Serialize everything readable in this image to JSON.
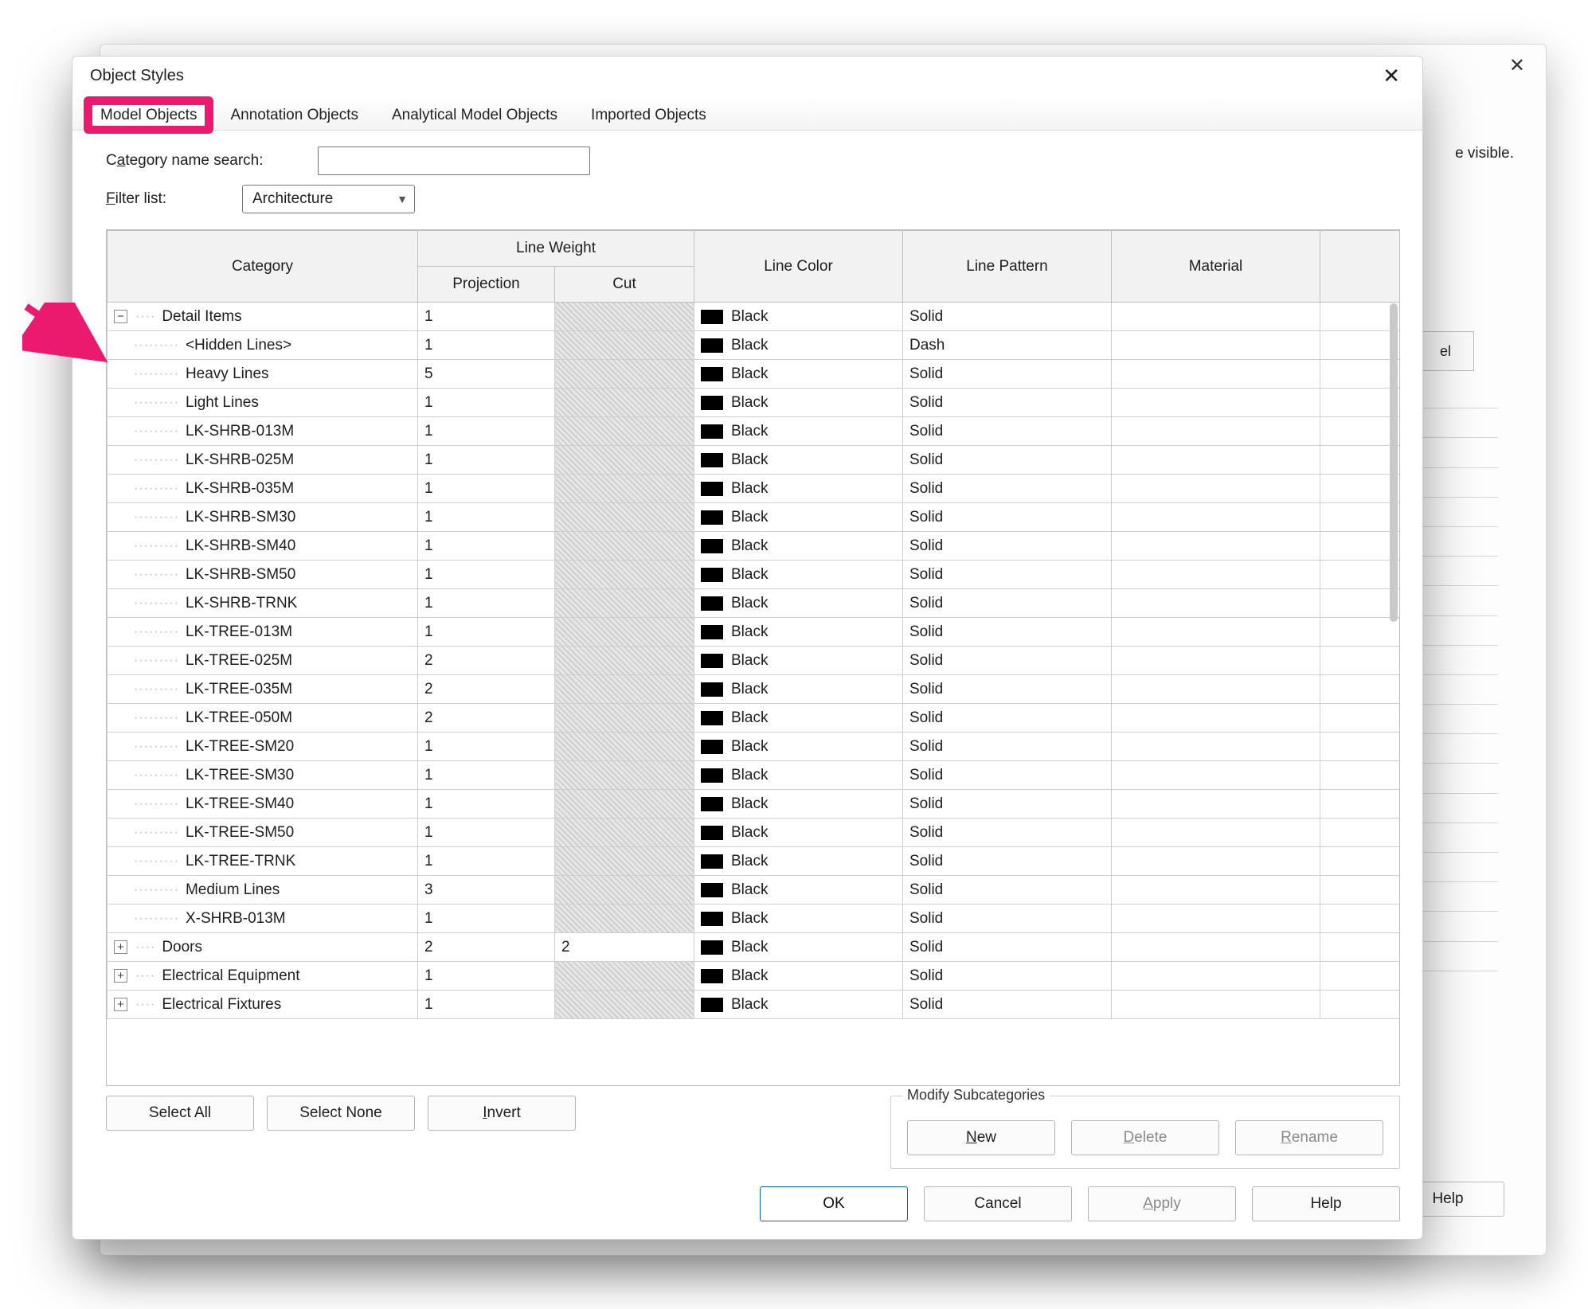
{
  "dialog": {
    "title": "Object Styles"
  },
  "tabs": {
    "model": "Model Objects",
    "annotation": "Annotation Objects",
    "analytical": "Analytical Model Objects",
    "imported": "Imported Objects"
  },
  "labels": {
    "category_search_pre": "C",
    "category_search_un": "a",
    "category_search_post": "tegory name search:",
    "filter_un": "F",
    "filter_post": "ilter list:",
    "filter_value": "Architecture"
  },
  "headers": {
    "category": "Category",
    "line_weight": "Line Weight",
    "projection": "Projection",
    "cut": "Cut",
    "line_color": "Line Color",
    "line_pattern": "Line Pattern",
    "material": "Material"
  },
  "color_black": "Black",
  "rows": [
    {
      "toggle": "minus",
      "indent": 0,
      "name": "Detail Items",
      "proj": "1",
      "cut": "disabled",
      "pattern": "Solid"
    },
    {
      "toggle": "",
      "indent": 1,
      "name": "<Hidden Lines>",
      "proj": "1",
      "cut": "disabled",
      "pattern": "Dash"
    },
    {
      "toggle": "",
      "indent": 1,
      "name": "Heavy Lines",
      "proj": "5",
      "cut": "disabled",
      "pattern": "Solid"
    },
    {
      "toggle": "",
      "indent": 1,
      "name": "Light Lines",
      "proj": "1",
      "cut": "disabled",
      "pattern": "Solid"
    },
    {
      "toggle": "",
      "indent": 1,
      "name": "LK-SHRB-013M",
      "proj": "1",
      "cut": "disabled",
      "pattern": "Solid"
    },
    {
      "toggle": "",
      "indent": 1,
      "name": "LK-SHRB-025M",
      "proj": "1",
      "cut": "disabled",
      "pattern": "Solid"
    },
    {
      "toggle": "",
      "indent": 1,
      "name": "LK-SHRB-035M",
      "proj": "1",
      "cut": "disabled",
      "pattern": "Solid"
    },
    {
      "toggle": "",
      "indent": 1,
      "name": "LK-SHRB-SM30",
      "proj": "1",
      "cut": "disabled",
      "pattern": "Solid"
    },
    {
      "toggle": "",
      "indent": 1,
      "name": "LK-SHRB-SM40",
      "proj": "1",
      "cut": "disabled",
      "pattern": "Solid"
    },
    {
      "toggle": "",
      "indent": 1,
      "name": "LK-SHRB-SM50",
      "proj": "1",
      "cut": "disabled",
      "pattern": "Solid"
    },
    {
      "toggle": "",
      "indent": 1,
      "name": "LK-SHRB-TRNK",
      "proj": "1",
      "cut": "disabled",
      "pattern": "Solid"
    },
    {
      "toggle": "",
      "indent": 1,
      "name": "LK-TREE-013M",
      "proj": "1",
      "cut": "disabled",
      "pattern": "Solid"
    },
    {
      "toggle": "",
      "indent": 1,
      "name": "LK-TREE-025M",
      "proj": "2",
      "cut": "disabled",
      "pattern": "Solid"
    },
    {
      "toggle": "",
      "indent": 1,
      "name": "LK-TREE-035M",
      "proj": "2",
      "cut": "disabled",
      "pattern": "Solid"
    },
    {
      "toggle": "",
      "indent": 1,
      "name": "LK-TREE-050M",
      "proj": "2",
      "cut": "disabled",
      "pattern": "Solid"
    },
    {
      "toggle": "",
      "indent": 1,
      "name": "LK-TREE-SM20",
      "proj": "1",
      "cut": "disabled",
      "pattern": "Solid"
    },
    {
      "toggle": "",
      "indent": 1,
      "name": "LK-TREE-SM30",
      "proj": "1",
      "cut": "disabled",
      "pattern": "Solid"
    },
    {
      "toggle": "",
      "indent": 1,
      "name": "LK-TREE-SM40",
      "proj": "1",
      "cut": "disabled",
      "pattern": "Solid"
    },
    {
      "toggle": "",
      "indent": 1,
      "name": "LK-TREE-SM50",
      "proj": "1",
      "cut": "disabled",
      "pattern": "Solid"
    },
    {
      "toggle": "",
      "indent": 1,
      "name": "LK-TREE-TRNK",
      "proj": "1",
      "cut": "disabled",
      "pattern": "Solid"
    },
    {
      "toggle": "",
      "indent": 1,
      "name": "Medium Lines",
      "proj": "3",
      "cut": "disabled",
      "pattern": "Solid"
    },
    {
      "toggle": "",
      "indent": 1,
      "name": "X-SHRB-013M",
      "proj": "1",
      "cut": "disabled",
      "pattern": "Solid"
    },
    {
      "toggle": "plus",
      "indent": 0,
      "name": "Doors",
      "proj": "2",
      "cut": "2",
      "pattern": "Solid"
    },
    {
      "toggle": "plus",
      "indent": 0,
      "name": "Electrical Equipment",
      "proj": "1",
      "cut": "disabled",
      "pattern": "Solid"
    },
    {
      "toggle": "plus",
      "indent": 0,
      "name": "Electrical Fixtures",
      "proj": "1",
      "cut": "disabled",
      "pattern": "Solid"
    }
  ],
  "buttons": {
    "select_all": "Select All",
    "select_none": "Select None",
    "invert_un": "I",
    "invert_post": "nvert",
    "modify_legend": "Modify Subcategories",
    "new_un": "N",
    "new_post": "ew",
    "delete_un": "D",
    "delete_post": "elete",
    "rename_un": "R",
    "rename_post": "ename",
    "ok": "OK",
    "cancel": "Cancel",
    "apply_un": "A",
    "apply_post": "pply",
    "help": "Help"
  },
  "back": {
    "fragment": "e visible.",
    "header": "el",
    "help": "Help"
  }
}
